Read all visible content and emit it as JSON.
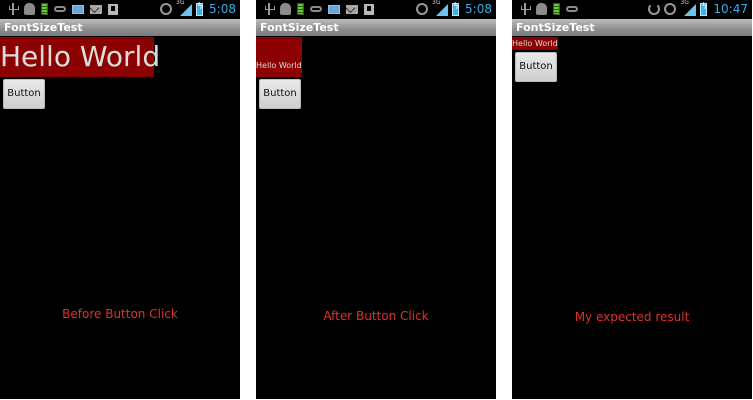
{
  "screens": [
    {
      "app_title": "FontSizeTest",
      "clock": "5:08",
      "network_label": "3G",
      "text_view": "Hello World",
      "button_label": "Button",
      "caption": "Before Button Click"
    },
    {
      "app_title": "FontSizeTest",
      "clock": "5:08",
      "network_label": "3G",
      "text_view": "Hello World",
      "button_label": "Button",
      "caption": "After Button Click"
    },
    {
      "app_title": "FontSizeTest",
      "clock": "10:47",
      "network_label": "3G",
      "text_view": "Hello World",
      "button_label": "Button",
      "caption": "My expected result"
    }
  ],
  "colors": {
    "background": "#000000",
    "text_view_background": "#8b0000",
    "caption": "#e0302b",
    "clock": "#36aee8"
  },
  "icons": [
    "usb-icon",
    "android-debug-icon",
    "battery-green-icon",
    "voicemail-icon",
    "keyboard-icon",
    "gmail-icon",
    "download-icon",
    "sync-icon",
    "alarm-icon",
    "signal-icon",
    "battery-icon"
  ]
}
